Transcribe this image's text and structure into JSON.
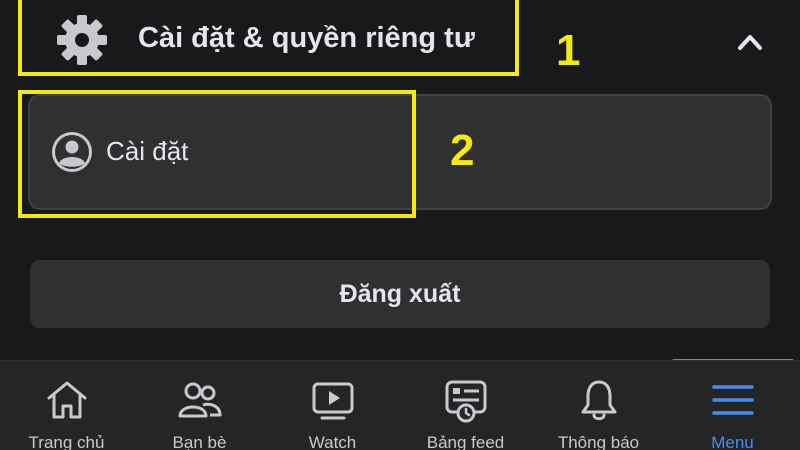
{
  "section": {
    "title": "Cài đặt & quyền riêng tư",
    "icon": "gear-icon",
    "toggle_icon": "chevron-up-icon"
  },
  "settings_item": {
    "label": "Cài đặt",
    "icon": "person-icon"
  },
  "logout": {
    "label": "Đăng xuất"
  },
  "callouts": [
    {
      "number": "1"
    },
    {
      "number": "2"
    }
  ],
  "tabs": [
    {
      "label": "Trang chủ",
      "icon": "home-icon",
      "active": false
    },
    {
      "label": "Bạn bè",
      "icon": "friends-icon",
      "active": false
    },
    {
      "label": "Watch",
      "icon": "watch-icon",
      "active": false
    },
    {
      "label": "Bảng feed",
      "icon": "feed-icon",
      "active": false
    },
    {
      "label": "Thông báo",
      "icon": "bell-icon",
      "active": false
    },
    {
      "label": "Menu",
      "icon": "menu-icon",
      "active": true
    }
  ],
  "colors": {
    "background": "#18191b",
    "card": "#2f3032",
    "callout": "#f5ea10",
    "accent": "#4a8bf0",
    "text": "#e4e6eb"
  }
}
